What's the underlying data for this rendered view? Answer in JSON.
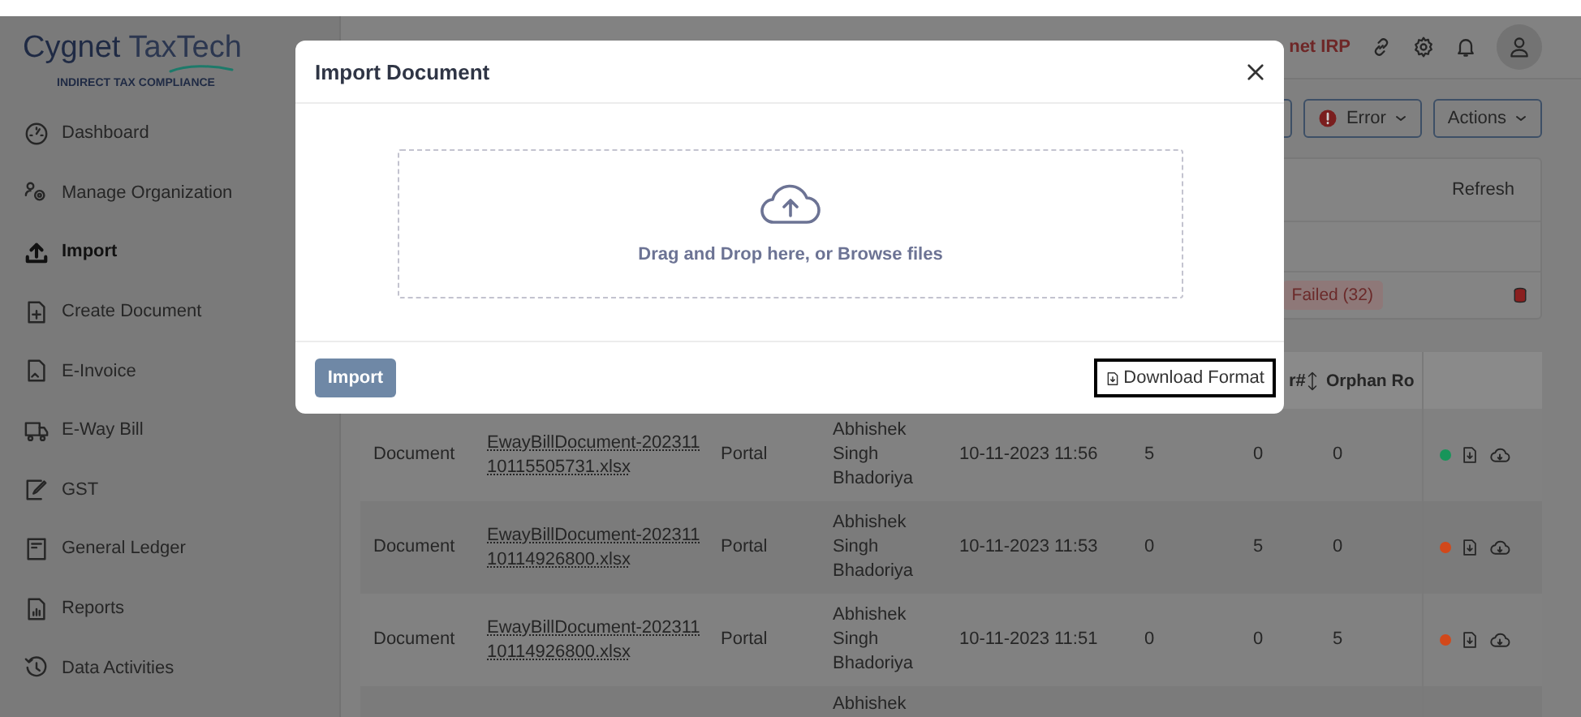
{
  "sidebar": {
    "brand": "Cygnet",
    "brand_suffix": "TaxTech",
    "tagline": "INDIRECT TAX COMPLIANCE",
    "items": [
      {
        "label": "Dashboard",
        "selected": false
      },
      {
        "label": "Manage Organization",
        "selected": false
      },
      {
        "label": "Import",
        "selected": true
      },
      {
        "label": "Create Document",
        "selected": false
      },
      {
        "label": "E-Invoice",
        "selected": false
      },
      {
        "label": "E-Way Bill",
        "selected": false
      },
      {
        "label": "GST",
        "selected": false
      },
      {
        "label": "General Ledger",
        "selected": false
      },
      {
        "label": "Reports",
        "selected": false
      },
      {
        "label": "Data Activities",
        "selected": false
      }
    ]
  },
  "header": {
    "org_name": "net IRP"
  },
  "toolbar": {
    "buttons": [
      {
        "label": "Error",
        "kind": "error"
      },
      {
        "label": "Actions",
        "kind": "plain"
      }
    ]
  },
  "summary_card": {
    "refresh": "Refresh",
    "status_badge": "Failed (32)"
  },
  "table": {
    "columns": [
      {
        "label": "r#",
        "sortable": true
      },
      {
        "label": "Orphan Ro",
        "sortable": false
      }
    ],
    "rows": [
      {
        "type": "Document",
        "file": "EwayBillDocument-20231110115505731.xlsx",
        "source": "Portal",
        "user": "Abhishek Singh Bhadoriya",
        "date": "10-11-2023 11:56",
        "count_1": "5",
        "count_2": "0",
        "count_3": "0",
        "color": "#17955a"
      },
      {
        "type": "Document",
        "file": "EwayBillDocument-20231110114926800.xlsx",
        "source": "Portal",
        "user": "Abhishek Singh Bhadoriya",
        "date": "10-11-2023 11:53",
        "count_1": "0",
        "count_2": "5",
        "count_3": "0",
        "color": "#d2481a"
      },
      {
        "type": "Document",
        "file": "EwayBillDocument-20231110114926800.xlsx",
        "source": "Portal",
        "user": "Abhishek Singh Bhadoriya",
        "date": "10-11-2023 11:51",
        "count_1": "0",
        "count_2": "0",
        "count_3": "5",
        "color": "#d2481a"
      },
      {
        "user": "Abhishek"
      }
    ]
  },
  "modal": {
    "title": "Import Document",
    "dropzone_text": "Drag and Drop here, or Browse files",
    "import_button": "Import",
    "import_disabled": true,
    "download_link": "Download Format",
    "download_focused": true
  }
}
